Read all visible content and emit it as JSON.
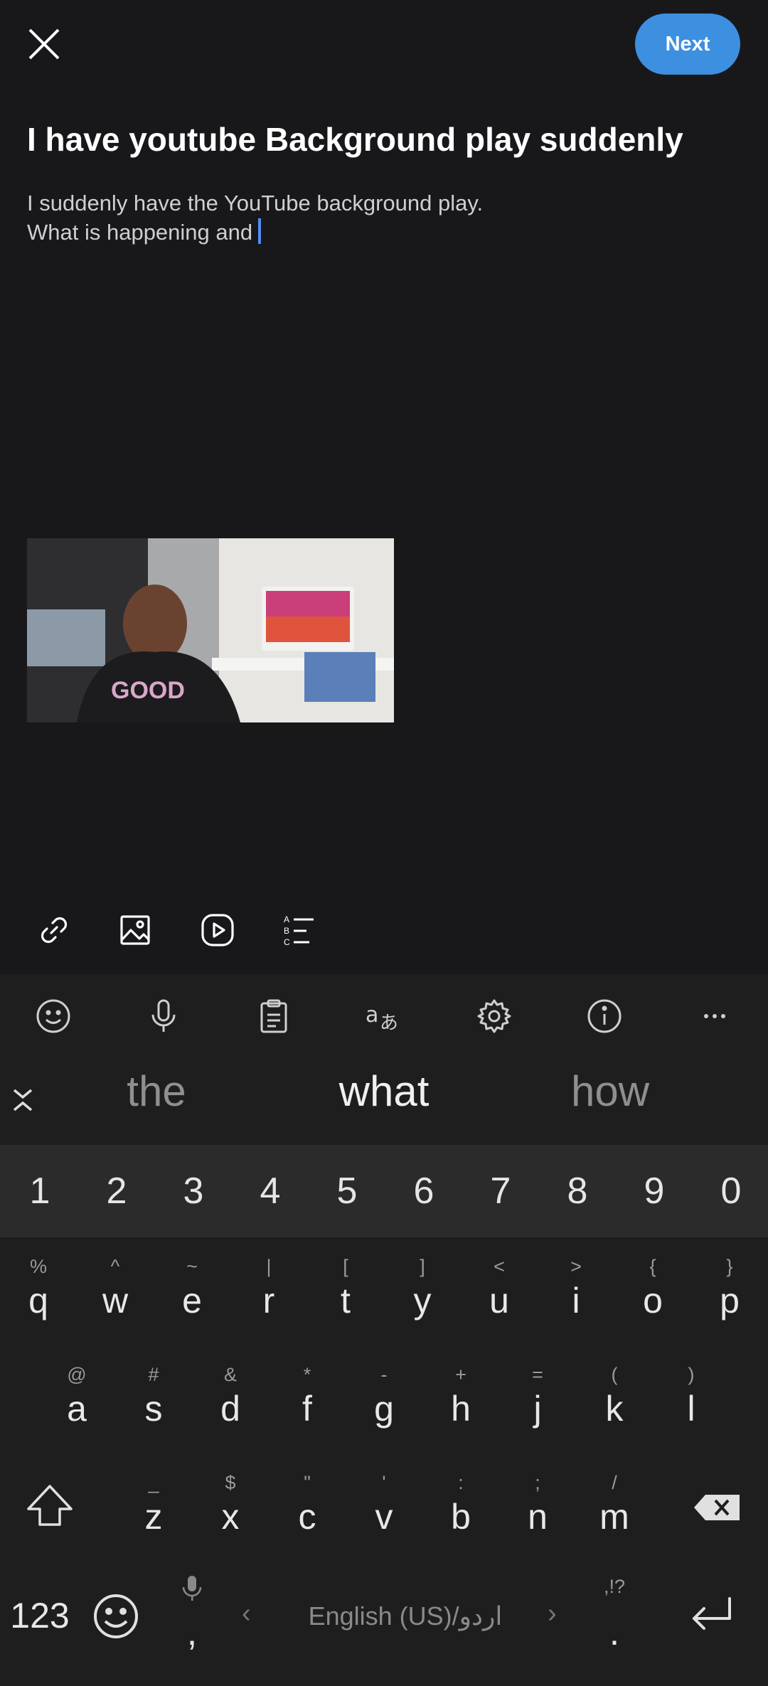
{
  "header": {
    "next_label": "Next"
  },
  "post": {
    "title": "I have youtube Background play suddenly",
    "body_line1": "I suddenly have the YouTube background play.",
    "body_line2": "What is happening and"
  },
  "toolbar_icons": [
    "link-icon",
    "image-icon",
    "video-icon",
    "list-icon"
  ],
  "keyboard": {
    "top_icons": [
      "emoji-icon",
      "mic-icon",
      "clipboard-icon",
      "translate-icon",
      "settings-icon",
      "info-icon",
      "more-icon"
    ],
    "suggestions": [
      "the",
      "what",
      "how"
    ],
    "numbers": [
      "1",
      "2",
      "3",
      "4",
      "5",
      "6",
      "7",
      "8",
      "9",
      "0"
    ],
    "row1": [
      {
        "k": "q",
        "h": "%"
      },
      {
        "k": "w",
        "h": "^"
      },
      {
        "k": "e",
        "h": "~"
      },
      {
        "k": "r",
        "h": "|"
      },
      {
        "k": "t",
        "h": "["
      },
      {
        "k": "y",
        "h": "]"
      },
      {
        "k": "u",
        "h": "<"
      },
      {
        "k": "i",
        "h": ">"
      },
      {
        "k": "o",
        "h": "{"
      },
      {
        "k": "p",
        "h": "}"
      }
    ],
    "row2": [
      {
        "k": "a",
        "h": "@"
      },
      {
        "k": "s",
        "h": "#"
      },
      {
        "k": "d",
        "h": "&"
      },
      {
        "k": "f",
        "h": "*"
      },
      {
        "k": "g",
        "h": "-"
      },
      {
        "k": "h",
        "h": "+"
      },
      {
        "k": "j",
        "h": "="
      },
      {
        "k": "k",
        "h": "("
      },
      {
        "k": "l",
        "h": ")"
      }
    ],
    "row3": [
      {
        "k": "z",
        "h": "_"
      },
      {
        "k": "x",
        "h": "$"
      },
      {
        "k": "c",
        "h": "\""
      },
      {
        "k": "v",
        "h": "'"
      },
      {
        "k": "b",
        "h": ":"
      },
      {
        "k": "n",
        "h": ";"
      },
      {
        "k": "m",
        "h": "/"
      }
    ],
    "mode_label": "123",
    "comma": ",",
    "space_label": "English (US)/اردو",
    "period": ".",
    "period_hint": ",!?"
  }
}
